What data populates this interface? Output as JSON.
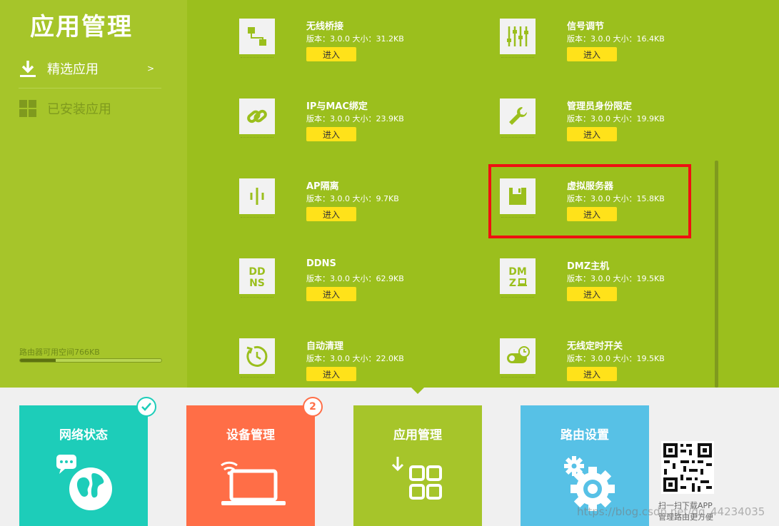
{
  "sidebar": {
    "title": "应用管理",
    "nav": [
      {
        "label": "精选应用",
        "chevron": ">"
      },
      {
        "label": "已安装应用"
      }
    ],
    "storage_label": "路由器可用空间766KB",
    "storage_used_fraction": 0.25
  },
  "apps": [
    {
      "name": "无线桥接",
      "meta": "版本：3.0.0  大小：31.2KB",
      "button": "进入",
      "icon": "network-bridge-icon"
    },
    {
      "name": "信号调节",
      "meta": "版本：3.0.0  大小：16.4KB",
      "button": "进入",
      "icon": "sliders-icon"
    },
    {
      "name": "IP与MAC绑定",
      "meta": "版本：3.0.0  大小：23.9KB",
      "button": "进入",
      "icon": "link-icon"
    },
    {
      "name": "管理员身份限定",
      "meta": "版本：3.0.0  大小：19.9KB",
      "button": "进入",
      "icon": "wrench-icon"
    },
    {
      "name": "AP隔离",
      "meta": "版本：3.0.0  大小：9.7KB",
      "button": "进入",
      "icon": "ap-isolation-icon"
    },
    {
      "name": "虚拟服务器",
      "meta": "版本：3.0.0  大小：15.8KB",
      "button": "进入",
      "icon": "floppy-disk-icon"
    },
    {
      "name": "DDNS",
      "meta": "版本：3.0.0  大小：62.9KB",
      "button": "进入",
      "icon": "ddns-icon",
      "icon_text": [
        "DD",
        "NS"
      ]
    },
    {
      "name": "DMZ主机",
      "meta": "版本：3.0.0  大小：19.5KB",
      "button": "进入",
      "icon": "dmz-icon",
      "icon_text": [
        "DM",
        "Z"
      ]
    },
    {
      "name": "自动清理",
      "meta": "版本：3.0.0  大小：22.0KB",
      "button": "进入",
      "icon": "auto-clean-icon"
    },
    {
      "name": "无线定时开关",
      "meta": "版本：3.0.0  大小：19.5KB",
      "button": "进入",
      "icon": "timer-toggle-icon"
    }
  ],
  "tiles": [
    {
      "label": "网络状态",
      "color": "#1dcdb9",
      "icon": "globe-chat-icon",
      "badge": "check-icon"
    },
    {
      "label": "设备管理",
      "color": "#ff6e47",
      "icon": "laptop-wifi-icon",
      "badge_count": "2"
    },
    {
      "label": "应用管理",
      "color": "#a6c52a",
      "icon": "apps-grid-icon"
    },
    {
      "label": "路由设置",
      "color": "#57c1e6",
      "icon": "gear-icon"
    }
  ],
  "qr": {
    "line1": "扫一扫下载APP",
    "line2": "管理路由更方便"
  },
  "watermark": "https://blog.csdn.net/qq_44234035",
  "colors": {
    "highlight": "#ee1111",
    "button": "#ffe21a",
    "main_bg": "#9bbf1d",
    "sidebar_bg": "#a6c52a"
  }
}
